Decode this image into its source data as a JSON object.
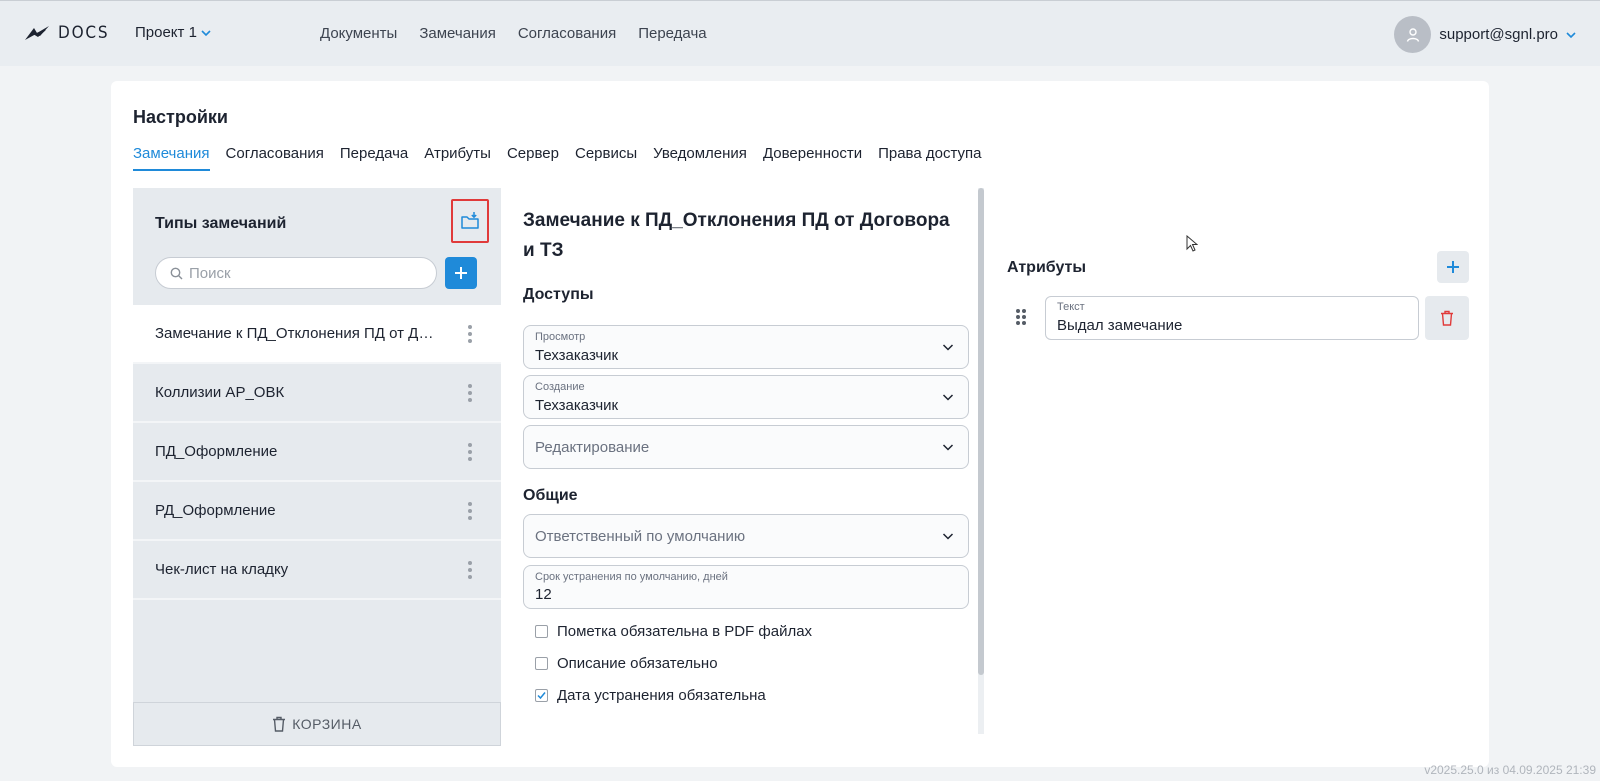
{
  "header": {
    "logo_text": "DOCS",
    "project": "Проект 1",
    "nav": [
      "Документы",
      "Замечания",
      "Согласования",
      "Передача"
    ],
    "user_email": "support@sgnl.pro"
  },
  "page": {
    "title": "Настройки",
    "tabs": [
      "Замечания",
      "Согласования",
      "Передача",
      "Атрибуты",
      "Сервер",
      "Сервисы",
      "Уведомления",
      "Доверенности",
      "Права доступа"
    ],
    "active_tab": "Замечания"
  },
  "types_panel": {
    "title": "Типы замечаний",
    "search_placeholder": "Поиск",
    "items": [
      "Замечание к ПД_Отклонения ПД от Договора и ТЗ",
      "Коллизии АР_ОВК",
      "ПД_Оформление",
      "РД_Оформление",
      "Чек-лист на кладку"
    ],
    "trash_label": "КОРЗИНА"
  },
  "detail": {
    "title": "Замечание к ПД_Отклонения ПД от Договора и ТЗ",
    "access_section": "Доступы",
    "view_label": "Просмотр",
    "view_value": "Техзаказчик",
    "create_label": "Создание",
    "create_value": "Техзаказчик",
    "edit_placeholder": "Редактирование",
    "general_section": "Общие",
    "responsible_placeholder": "Ответственный по умолчанию",
    "deadline_label": "Срок устранения по умолчанию, дней",
    "deadline_value": "12",
    "checkboxes": [
      {
        "label": "Пометка обязательна в PDF файлах",
        "checked": false
      },
      {
        "label": "Описание обязательно",
        "checked": false
      },
      {
        "label": "Дата устранения обязательна",
        "checked": true
      }
    ]
  },
  "attributes": {
    "title": "Атрибуты",
    "field_label": "Текст",
    "field_value": "Выдал замечание"
  },
  "footer": {
    "version": "v2025.25.0 из 04.09.2025 21:39"
  },
  "colors": {
    "accent": "#1f8ad9",
    "highlight_border": "#e03a3a",
    "delete_icon": "#e03a3a"
  }
}
